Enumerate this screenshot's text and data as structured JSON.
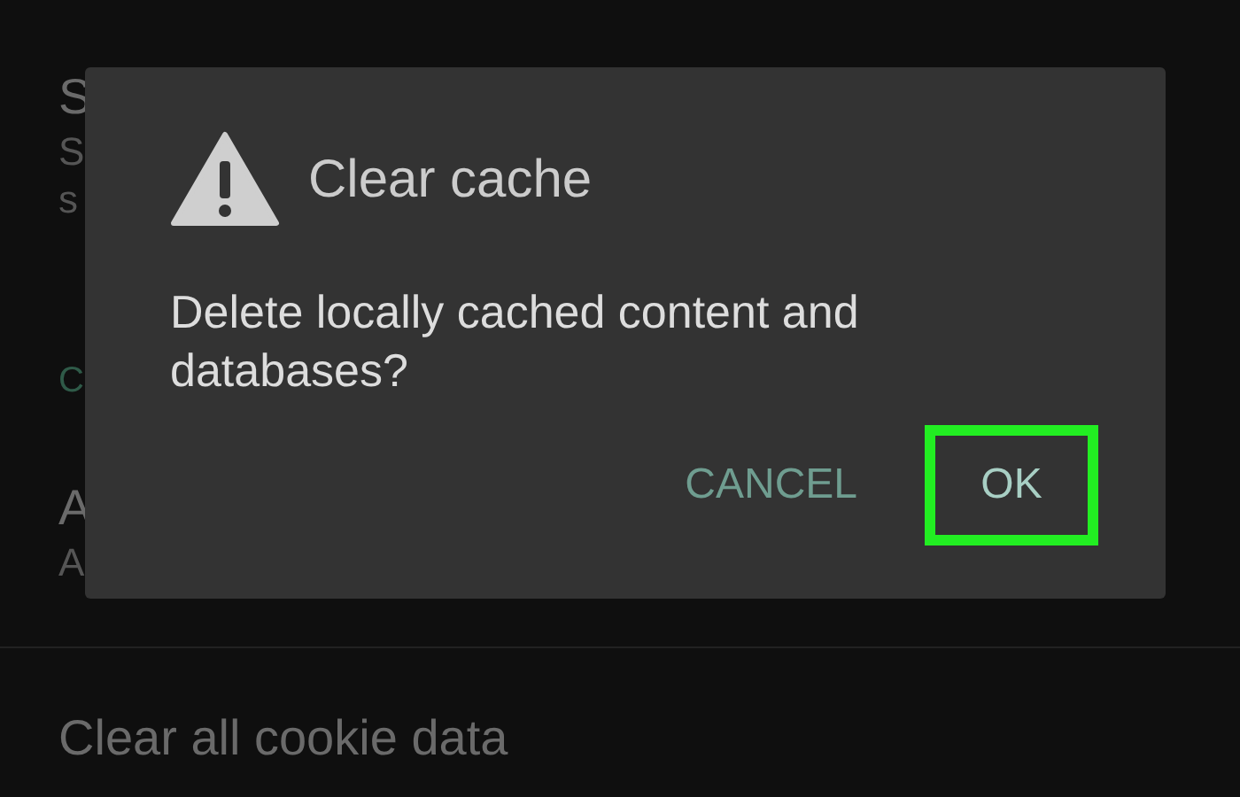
{
  "background": {
    "rows": [
      {
        "kind": "item",
        "title": "S",
        "summary": "S",
        "summary_2": "s"
      },
      {
        "kind": "header",
        "title": "C"
      },
      {
        "kind": "item",
        "title": "A",
        "summary": "A"
      },
      {
        "kind": "item",
        "title": "Clear all cookie data"
      }
    ]
  },
  "dialog": {
    "title": "Clear cache",
    "message": "Delete locally cached content and databases?",
    "buttons": [
      {
        "label": "CANCEL",
        "highlighted": false
      },
      {
        "label": "OK",
        "highlighted": true
      }
    ]
  }
}
